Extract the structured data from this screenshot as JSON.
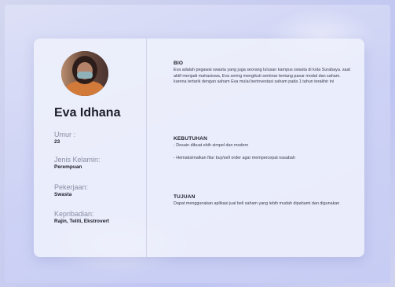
{
  "profile": {
    "name": "Eva Idhana",
    "fields": [
      {
        "label": "Umur :",
        "value": "23"
      },
      {
        "label": "Jenis Kelamin:",
        "value": "Perempuan"
      },
      {
        "label": "Pekerjaan:",
        "value": "Swasta"
      },
      {
        "label": "Kepribadian:",
        "value": "Rajin, Teliti, Ekstrovert"
      }
    ]
  },
  "sections": {
    "bio": {
      "title": "BIO",
      "text": "Eva adalah pegawai swasta yang juga seorang lulusan kampus swasta di kota Surabaya. saat aktif menjadi mahasiswa, Eva sering mengikuti seminar tentang pasar modal dan saham. karena tertarik dengan saham Eva mulai berinvestasi saham pada 1 tahun terakhir ini"
    },
    "kebutuhan": {
      "title": "KEBUTUHAN",
      "item1": "- Desain dibuat ebih simpel dan modern",
      "item2": "- Hemaksimalkan fitur buy/sell order agar mempercepat nasabah"
    },
    "tujuan": {
      "title": "TUJUAN",
      "text": "Dapat menggunakan aplikasi jual beli saham yang lebih mudah dipahami dan digunakan"
    }
  }
}
